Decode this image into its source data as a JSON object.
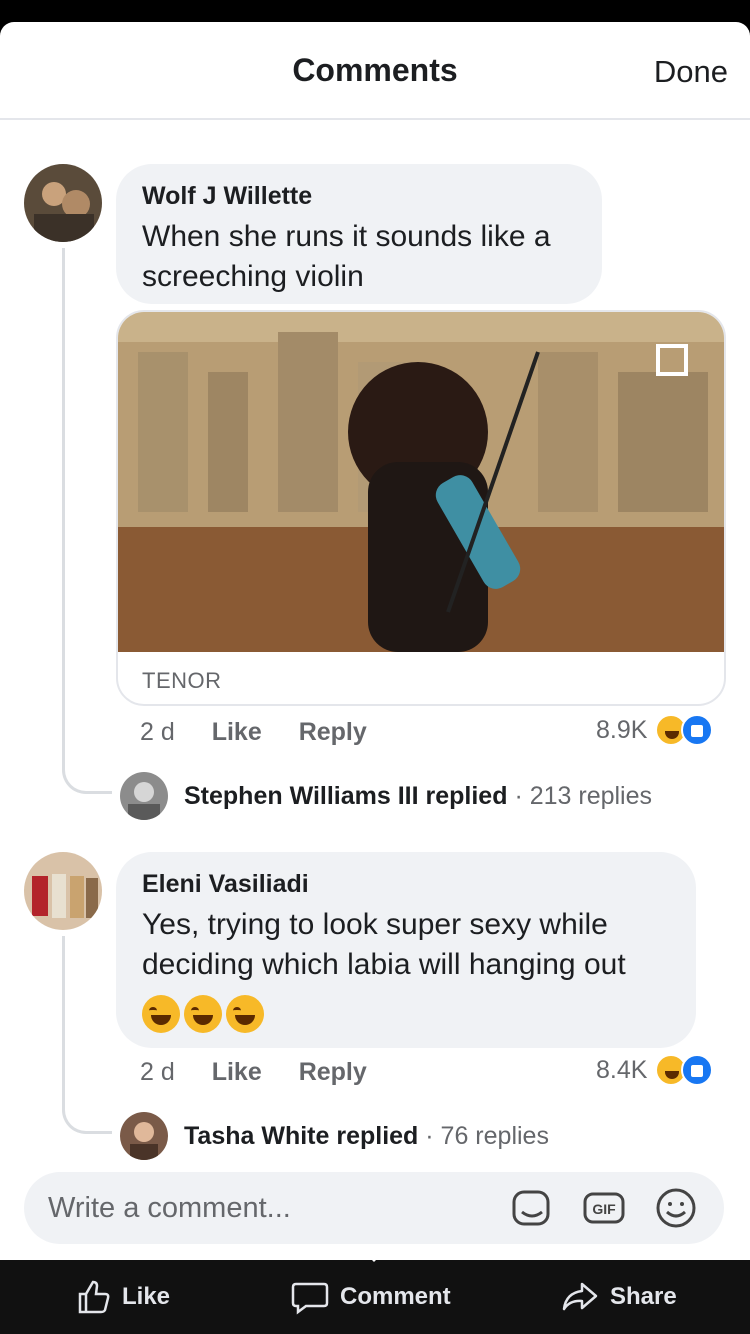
{
  "header": {
    "title": "Comments",
    "done_label": "Done"
  },
  "comments": [
    {
      "author": "Wolf J Willette",
      "text": "When she runs it sounds like a screeching violin",
      "attachment": {
        "source": "TENOR"
      },
      "age": "2 d",
      "like_label": "Like",
      "reply_label": "Reply",
      "reaction_count": "8.9K",
      "reactions": [
        "haha-icon",
        "like-icon"
      ],
      "reply_summary": {
        "name": "Stephen Williams III",
        "verb": "replied",
        "count": "· 213 replies"
      }
    },
    {
      "author": "Eleni Vasiliadi",
      "text": "Yes, trying to look super sexy while deciding which labia will hanging out",
      "emojis": [
        "rofl-emoji",
        "rofl-emoji",
        "rofl-emoji"
      ],
      "age": "2 d",
      "like_label": "Like",
      "reply_label": "Reply",
      "reaction_count": "8.4K",
      "reactions": [
        "haha-icon",
        "like-icon"
      ],
      "reply_summary": {
        "name": "Tasha White",
        "verb": "replied",
        "count": "· 76 replies"
      }
    }
  ],
  "composer": {
    "placeholder": "Write a comment...",
    "icons": [
      "sticker-icon",
      "gif-icon",
      "emoji-icon"
    ]
  },
  "bottom_bar": {
    "like": "Like",
    "comment": "Comment",
    "share": "Share"
  },
  "colors": {
    "accent": "#1877f2",
    "bubble": "#f0f2f5",
    "muted": "#65676b",
    "haha": "#f7b928"
  }
}
